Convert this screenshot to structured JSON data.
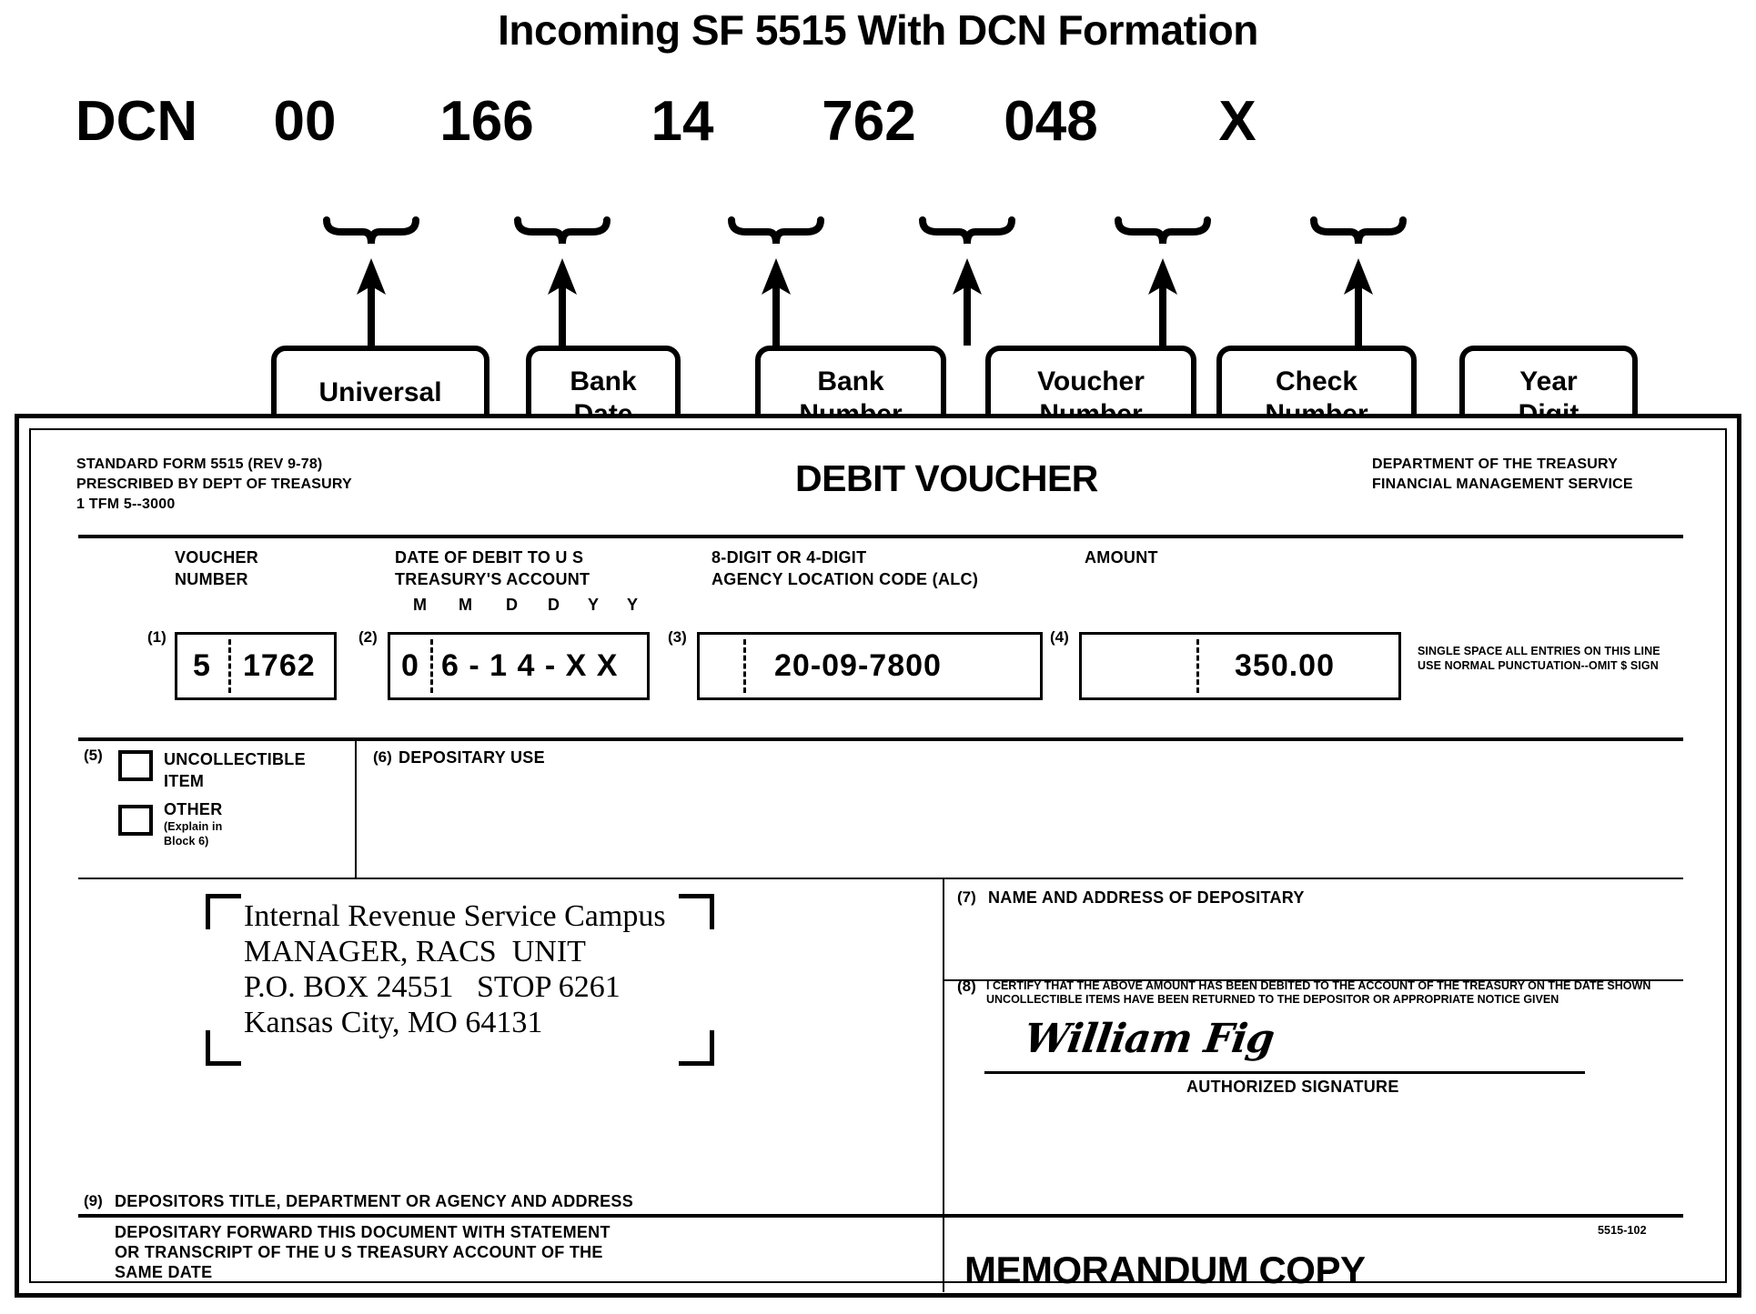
{
  "page": {
    "title": "Incoming SF 5515 With DCN Formation"
  },
  "dcn": {
    "segments": [
      {
        "value": "DCN",
        "is_label": true
      },
      {
        "value": "00",
        "is_label": false,
        "explains": "Universal Location Code"
      },
      {
        "value": "166",
        "is_label": false,
        "explains": "Bank Date"
      },
      {
        "value": "14",
        "is_label": false,
        "explains": "Bank Number"
      },
      {
        "value": "762",
        "is_label": false,
        "explains": "Voucher Number"
      },
      {
        "value": "048",
        "is_label": false,
        "explains": "Check Number"
      },
      {
        "value": "X",
        "is_label": false,
        "explains": "Year Digit"
      }
    ],
    "callouts": [
      "Universal\nLocation\nCode",
      "Bank\nDate",
      "Bank\nNumber",
      "Voucher\nNumber",
      "Check\nNumber",
      "Year\nDigit"
    ]
  },
  "form": {
    "header_left": [
      "STANDARD FORM 5515 (REV  9-78)",
      "PRESCRIBED BY DEPT  OF TREASURY",
      "1 TFM 5--3000"
    ],
    "title": "DEBIT VOUCHER",
    "header_right": [
      "DEPARTMENT OF THE TREASURY",
      "FINANCIAL MANAGEMENT SERVICE"
    ],
    "column_labels": {
      "voucher_number": "VOUCHER\nNUMBER",
      "date_of_debit": "DATE OF DEBIT TO U  S\nTREASURY'S ACCOUNT",
      "date_mmddyy": [
        "M",
        "M",
        "D",
        "D",
        "Y",
        "Y"
      ],
      "alc": "8-DIGIT OR 4-DIGIT\nAGENCY LOCATION CODE (ALC)",
      "amount": "AMOUNT"
    },
    "fields": [
      {
        "num": "(1)",
        "prefix": "5",
        "value": "1762"
      },
      {
        "num": "(2)",
        "prefix": "0",
        "value": "6 - 1 4 - X X"
      },
      {
        "num": "(3)",
        "prefix": "",
        "value": "20-09-7800"
      },
      {
        "num": "(4)",
        "prefix": "",
        "value": "350.00"
      }
    ],
    "entry_note": [
      "SINGLE SPACE ALL ENTRIES ON THIS LINE",
      "USE NORMAL PUNCTUATION--OMIT $ SIGN"
    ],
    "block5": {
      "num": "(5)",
      "options": [
        {
          "label": "UNCOLLECTIBLE\nITEM",
          "checked": false
        },
        {
          "label": "OTHER",
          "sub": "(Explain in\nBlock 6)",
          "checked": false
        }
      ]
    },
    "block6": {
      "num": "(6)",
      "label": "DEPOSITARY USE"
    },
    "block7": {
      "num": "(7)",
      "label": "NAME AND ADDRESS OF DEPOSITARY"
    },
    "block8": {
      "num": "(8)",
      "certification": [
        "I CERTIFY THAT THE ABOVE AMOUNT HAS BEEN DEBITED TO THE ACCOUNT OF THE TREASURY ON THE DATE SHOWN",
        "UNCOLLECTIBLE ITEMS HAVE BEEN RETURNED TO THE DEPOSITOR OR APPROPRIATE NOTICE GIVEN"
      ],
      "signature": "William Fig",
      "signature_caption": "AUTHORIZED SIGNATURE"
    },
    "block9": {
      "num": "(9)",
      "label": "DEPOSITORS TITLE, DEPARTMENT OR AGENCY AND ADDRESS",
      "instructions": [
        "DEPOSITARY FORWARD THIS DOCUMENT WITH STATEMENT",
        "OR TRANSCRIPT OF THE U  S  TREASURY ACCOUNT OF THE",
        "SAME DATE"
      ]
    },
    "address": [
      "Internal Revenue Service Campus",
      "MANAGER, RACS  UNIT",
      "P.O. BOX 24551   STOP 6261",
      "Kansas City, MO 64131"
    ],
    "memorandum_copy": "MEMORANDUM COPY",
    "form_code": "5515-102"
  }
}
